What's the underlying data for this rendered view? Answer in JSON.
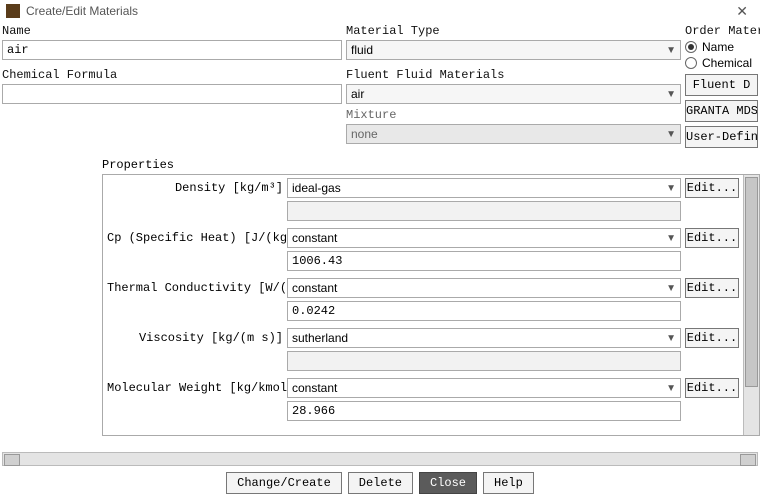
{
  "window": {
    "title": "Create/Edit Materials"
  },
  "left": {
    "name_label": "Name",
    "name_value": "air",
    "formula_label": "Chemical Formula",
    "formula_value": ""
  },
  "mid": {
    "mtype_label": "Material Type",
    "mtype_value": "fluid",
    "ffm_label": "Fluent Fluid Materials",
    "ffm_value": "air",
    "mix_label": "Mixture",
    "mix_value": "none"
  },
  "right": {
    "order_label": "Order Materi",
    "radio_name": "Name",
    "radio_chem": "Chemical",
    "btn_fluent": "Fluent D",
    "btn_granta": "GRANTA MDS",
    "btn_user": "User-Define"
  },
  "props": {
    "title": "Properties",
    "edit_label": "Edit...",
    "rows": [
      {
        "label": "Density [kg/m³]",
        "method": "ideal-gas",
        "value": ""
      },
      {
        "label": "Cp (Specific Heat) [J/(kg K)]",
        "method": "constant",
        "value": "1006.43"
      },
      {
        "label": "Thermal Conductivity [W/(m K)]",
        "method": "constant",
        "value": "0.0242"
      },
      {
        "label": "Viscosity [kg/(m s)]",
        "method": "sutherland",
        "value": ""
      },
      {
        "label": "Molecular Weight [kg/kmol]",
        "method": "constant",
        "value": "28.966"
      }
    ]
  },
  "footer": {
    "change": "Change/Create",
    "delete": "Delete",
    "close": "Close",
    "help": "Help"
  }
}
